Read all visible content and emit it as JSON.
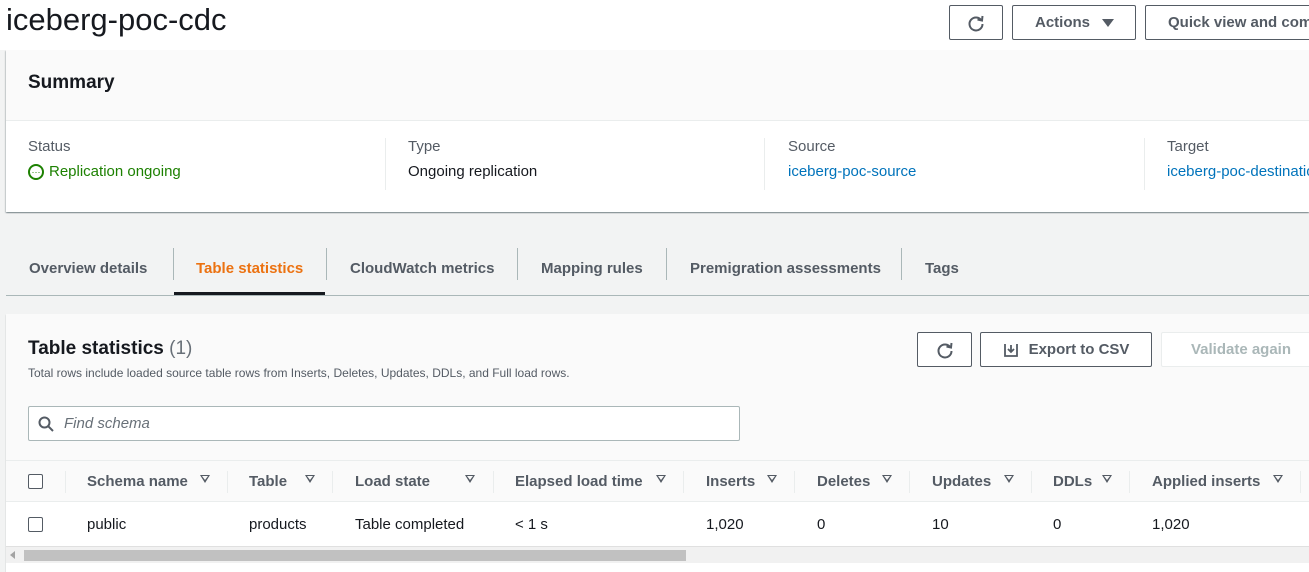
{
  "header": {
    "title": "iceberg-poc-cdc",
    "actions_label": "Actions",
    "quick_view_label": "Quick view and compare"
  },
  "summary": {
    "title": "Summary",
    "status": {
      "label": "Status",
      "value": "Replication ongoing"
    },
    "type": {
      "label": "Type",
      "value": "Ongoing replication"
    },
    "source": {
      "label": "Source",
      "value": "iceberg-poc-source"
    },
    "target": {
      "label": "Target",
      "value": "iceberg-poc-destination"
    }
  },
  "tabs": [
    {
      "label": "Overview details"
    },
    {
      "label": "Table statistics",
      "active": true
    },
    {
      "label": "CloudWatch metrics"
    },
    {
      "label": "Mapping rules"
    },
    {
      "label": "Premigration assessments"
    },
    {
      "label": "Tags"
    }
  ],
  "table_stats": {
    "title": "Table statistics",
    "count": "(1)",
    "description": "Total rows include loaded source table rows from Inserts, Deletes, Updates, DDLs, and Full load rows.",
    "export_label": "Export to CSV",
    "validate_label": "Validate again",
    "search_placeholder": "Find schema",
    "columns": [
      "Schema name",
      "Table",
      "Load state",
      "Elapsed load time",
      "Inserts",
      "Deletes",
      "Updates",
      "DDLs",
      "Applied inserts"
    ],
    "rows": [
      {
        "schema": "public",
        "table": "products",
        "load_state": "Table completed",
        "elapsed": "< 1 s",
        "inserts": "1,020",
        "deletes": "0",
        "updates": "10",
        "ddls": "0",
        "applied_inserts": "1,020"
      }
    ]
  },
  "colors": {
    "accent": "#ec7211",
    "link": "#0073bb",
    "success": "#1d8102",
    "text": "#16191f",
    "muted": "#545b64"
  }
}
